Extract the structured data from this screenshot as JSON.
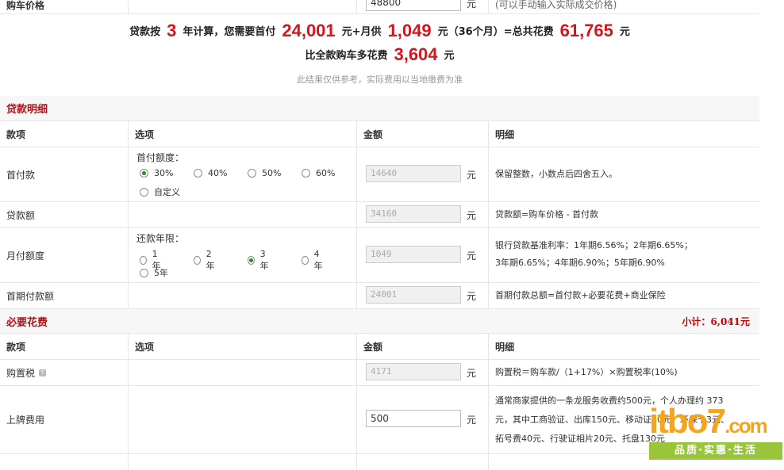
{
  "top_row": {
    "label": "购车价格",
    "value": "48800",
    "unit": "元",
    "hint": "(可以手动输入实际成交价格)"
  },
  "summary": {
    "pre": "贷款按",
    "years": "3",
    "mid1": "年计算，您需要首付",
    "down": "24,001",
    "mid2": "元+月供",
    "monthly": "1,049",
    "mid3": "元（36个月）=总共花费",
    "total": "61,765",
    "post": "元",
    "line2_pre": "比全款购车多花费",
    "extra": "3,604",
    "line2_post": "元",
    "note": "此结果仅供参考，实际费用以当地缴费为准"
  },
  "loan": {
    "title": "贷款明细",
    "headers": [
      "款项",
      "选项",
      "金额",
      "明细"
    ],
    "down_payment": {
      "label": "首付款",
      "option_title": "首付额度：",
      "options": [
        "30%",
        "40%",
        "50%",
        "60%",
        "自定义"
      ],
      "selected": "30%",
      "value": "14640",
      "unit": "元",
      "detail": "保留整数，小数点后四舍五入。"
    },
    "loan_amount": {
      "label": "贷款额",
      "value": "34160",
      "unit": "元",
      "detail": "贷款额=购车价格 - 首付款"
    },
    "monthly": {
      "label": "月付额度",
      "option_title": "还款年限：",
      "options": [
        "1年",
        "2年",
        "3年",
        "4年",
        "5年"
      ],
      "selected": "3年",
      "value": "1049",
      "unit": "元",
      "detail1": "银行贷款基准利率：1年期6.56%；2年期6.65%；",
      "detail2": "3年期6.65%；4年期6.90%；5年期6.90%"
    },
    "first_total": {
      "label": "首期付款额",
      "value": "24001",
      "unit": "元",
      "detail": "首期付款总额=首付款+必要花费+商业保险"
    }
  },
  "required": {
    "title": "必要花费",
    "subtotal": "小计：6,041元",
    "headers": [
      "款项",
      "选项",
      "金额",
      "明细"
    ],
    "purchase_tax": {
      "label": "购置税",
      "help": "?",
      "value": "4171",
      "unit": "元",
      "detail": "购置税＝购车款/（1+17%）×购置税率(10%)"
    },
    "plate": {
      "label": "上牌费用",
      "value": "500",
      "unit": "元",
      "detail1": "通常商家提供的一条龙服务收费约500元，个人办理约 373",
      "detail2": "元，其中工商验证、出库150元、移动证30元、环保卡3元、",
      "detail3": "拓号费40元、行驶证相片20元、托盘130元"
    }
  },
  "watermark": {
    "brand": "itbo7",
    "suffix": ".com",
    "tagline": "品质·实惠·生活"
  },
  "colors": {
    "accent_red": "#d6141c",
    "section_red": "#b3121b",
    "radio_green": "#2a8a2a",
    "watermark_orange": "#f4a51c",
    "watermark_green": "#9ac43c"
  }
}
